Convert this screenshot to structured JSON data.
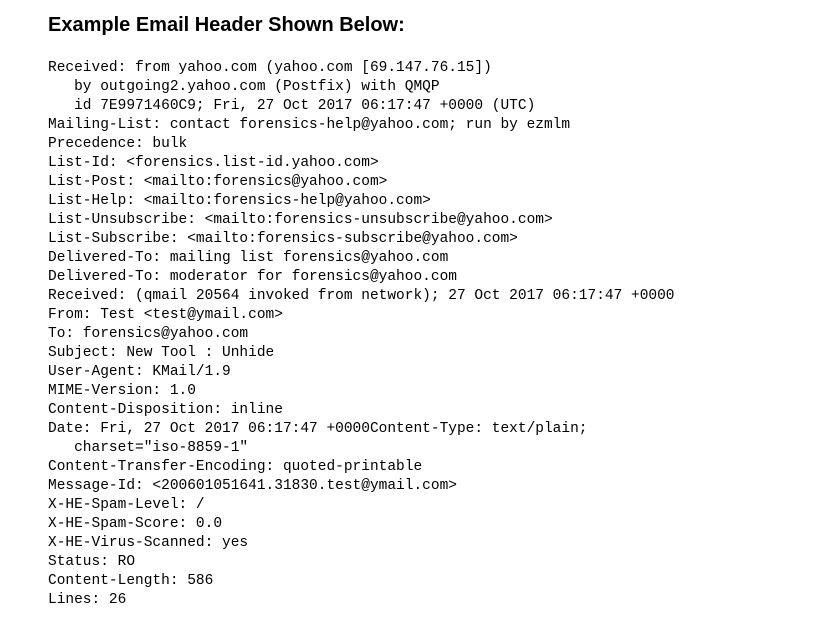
{
  "heading": "Example Email Header Shown Below:",
  "email_header": {
    "lines": [
      "Received: from yahoo.com (yahoo.com [69.147.76.15])",
      "   by outgoing2.yahoo.com (Postfix) with QMQP",
      "   id 7E9971460C9; Fri, 27 Oct 2017 06:17:47 +0000 (UTC)",
      "Mailing-List: contact forensics-help@yahoo.com; run by ezmlm",
      "Precedence: bulk",
      "List-Id: <forensics.list-id.yahoo.com>",
      "List-Post: <mailto:forensics@yahoo.com>",
      "List-Help: <mailto:forensics-help@yahoo.com>",
      "List-Unsubscribe: <mailto:forensics-unsubscribe@yahoo.com>",
      "List-Subscribe: <mailto:forensics-subscribe@yahoo.com>",
      "Delivered-To: mailing list forensics@yahoo.com",
      "Delivered-To: moderator for forensics@yahoo.com",
      "Received: (qmail 20564 invoked from network); 27 Oct 2017 06:17:47 +0000",
      "From: Test <test@ymail.com>",
      "To: forensics@yahoo.com",
      "Subject: New Tool : Unhide",
      "User-Agent: KMail/1.9",
      "MIME-Version: 1.0",
      "Content-Disposition: inline",
      "Date: Fri, 27 Oct 2017 06:17:47 +0000Content-Type: text/plain;",
      "   charset=\"iso-8859-1\"",
      "Content-Transfer-Encoding: quoted-printable",
      "Message-Id: <200601051641.31830.test@ymail.com>",
      "X-HE-Spam-Level: /",
      "X-HE-Spam-Score: 0.0",
      "X-HE-Virus-Scanned: yes",
      "Status: RO",
      "Content-Length: 586",
      "Lines: 26"
    ]
  }
}
